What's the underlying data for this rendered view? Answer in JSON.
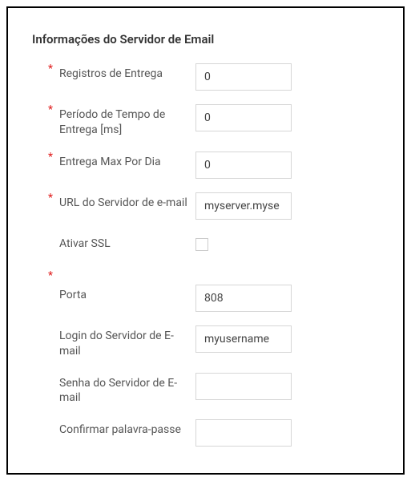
{
  "section_title": "Informações do Servidor de Email",
  "fields": {
    "delivery_records": {
      "label": "Registros de Entrega",
      "value": "0",
      "required": true
    },
    "delivery_period": {
      "label": "Período de Tempo de Entrega [ms]",
      "value": "0",
      "required": true
    },
    "max_per_day": {
      "label": "Entrega Max Por Dia",
      "value": "0",
      "required": true
    },
    "server_url": {
      "label": "URL do Servidor de e-mail",
      "value": "myserver.myse",
      "required": true
    },
    "enable_ssl": {
      "label": "Ativar SSL",
      "checked": false,
      "required": false
    },
    "port": {
      "label": "Porta",
      "value": "808",
      "required": true
    },
    "login": {
      "label": "Login do Servidor de E-mail",
      "value": "myusername",
      "required": false
    },
    "password": {
      "label": "Senha do Servidor de E-mail",
      "value": "",
      "required": false
    },
    "confirm_password": {
      "label": "Confirmar palavra-passe",
      "value": "",
      "required": false
    }
  },
  "required_marker": "*"
}
